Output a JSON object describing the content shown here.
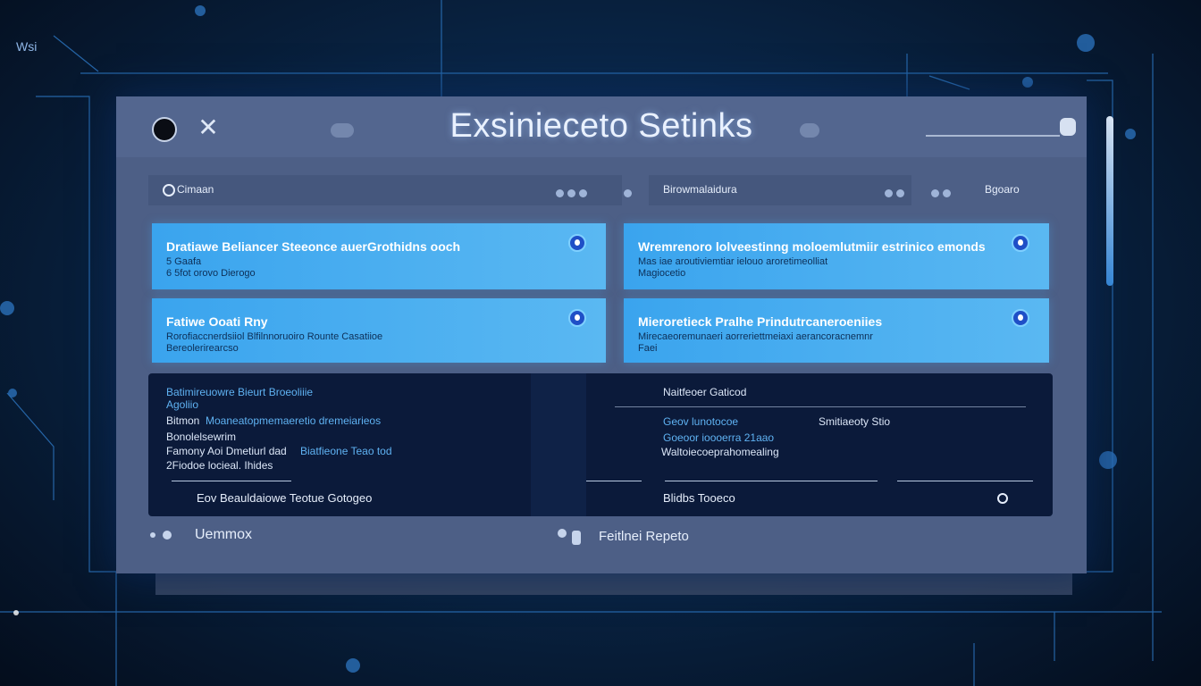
{
  "corner_label": "Wsi",
  "window": {
    "title": "Exsinieceto Setinks"
  },
  "toolbar": {
    "search_text": "Cimaan",
    "filter_text": "Birowmalaidura",
    "sort_label": "Bgoaro"
  },
  "cards": [
    {
      "title": "Dratiawe Beliancer Steeonce auerGrothidns ooch",
      "sub": "5 Gaafa",
      "sub2": "6 5fot orovo Dierogo"
    },
    {
      "title": "Wremrenoro lolveestinng moloemlutmiir estrinico emonds",
      "sub": "Mas iae aroutiviemtiar ielouo aroretimeolliat",
      "sub2": "Magiocetio"
    },
    {
      "title": "Fatiwe Ooati Rny",
      "sub": "Rorofiaccnerdsiiol Blfilnnoruoiro Rounte Casatiioe",
      "sub2": "Bereolerirearcso"
    },
    {
      "title": "Mieroretieck Pralhe Prindutrcaneroeniies",
      "sub": "Mirecaeoremunaeri aorreriettmeiaxi aerancoracnemnr",
      "sub2": "Faei"
    }
  ],
  "panel": {
    "left": [
      {
        "text": "Batimireuowre Bieurt Broeoliiie",
        "style": "blue"
      },
      {
        "text": "Agoliio",
        "style": "blue"
      },
      {
        "text": "Bitmon",
        "style": "light",
        "suffix": "Moaneatopmemaeretio dremeiarieos"
      },
      {
        "text": "Bonolelsewrim",
        "style": "light"
      },
      {
        "text": "Famony Aoi Dmetiurl dad",
        "style": "light",
        "suffix": "Biatfieone Teao  tod"
      },
      {
        "text": "2Fiodoe locieal. Ihides",
        "style": "light"
      }
    ],
    "right_header": "Naitfeoer Gaticod",
    "right": [
      {
        "text": "Geov lunotocoe",
        "style": "blue"
      },
      {
        "text": "Goeoor ioooerra 21aao",
        "style": "blue"
      },
      {
        "text": "Waltoiecoeprahomealing",
        "style": "light"
      }
    ],
    "right_mid_label": "Smitiaeoty Stio",
    "footer_left": "Eov  Beauldaiowe Teotue Gotogeo",
    "footer_right": "Blidbs Tooeco"
  },
  "bottom": {
    "left_label": "Uemmox",
    "right_label": "Feitlnei Repeto"
  }
}
